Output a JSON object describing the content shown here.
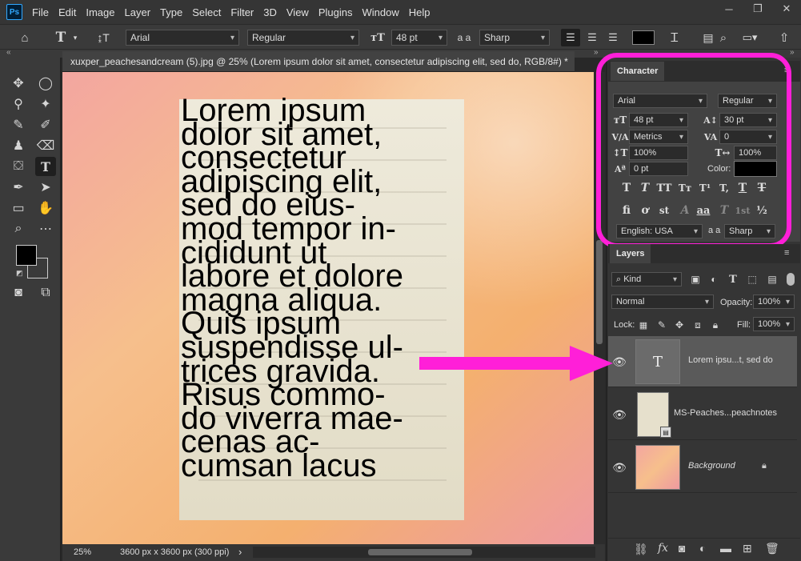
{
  "menubar": {
    "logo": "Ps",
    "items": [
      "File",
      "Edit",
      "Image",
      "Layer",
      "Type",
      "Select",
      "Filter",
      "3D",
      "View",
      "Plugins",
      "Window",
      "Help"
    ]
  },
  "options": {
    "font_family": "Arial",
    "font_style": "Regular",
    "font_size": "48 pt",
    "aa_label": "a a",
    "anti_alias": "Sharp"
  },
  "document": {
    "tab_title": "xuxper_peachesandcream (5).jpg @ 25% (Lorem ipsum dolor sit amet, consectetur adipiscing elit, sed do, RGB/8#) *",
    "tab_close": "×",
    "canvas_text_lines": [
      "Lorem ipsum",
      "dolor sit amet,",
      "consectetur",
      "adipiscing elit,",
      "sed do eius-",
      "mod tempor in-",
      "cididunt ut",
      "labore et dolore",
      "magna aliqua.",
      "Quis ipsum",
      "suspendisse ul-",
      "trices gravida.",
      "Risus commo-",
      "do viverra mae-",
      "cenas ac-",
      "cumsan lacus"
    ]
  },
  "status": {
    "zoom": "25%",
    "doc_info": "3600 px x 3600 px (300 ppi)",
    "arrow": "›"
  },
  "character_panel": {
    "tab": "Character",
    "font_family": "Arial",
    "font_style": "Regular",
    "size": "48 pt",
    "leading": "30 pt",
    "kerning": "Metrics",
    "tracking": "0",
    "vscale": "100%",
    "hscale": "100%",
    "baseline": "0 pt",
    "color_label": "Color:",
    "text_color": "#000000",
    "language": "English: USA",
    "aa_label": "a a",
    "anti_alias": "Sharp",
    "row1_glyphs": [
      "T",
      "T",
      "TT",
      "Tт",
      "T¹",
      "T,",
      "T",
      "T"
    ],
    "row2_glyphs": [
      "fi",
      "ơ",
      "st",
      "A",
      "aa",
      "T",
      "1st",
      "½"
    ]
  },
  "layers_panel": {
    "tab": "Layers",
    "filter": "Kind",
    "blend_mode": "Normal",
    "opacity_label": "Opacity:",
    "opacity": "100%",
    "lock_label": "Lock:",
    "fill_label": "Fill:",
    "fill": "100%",
    "layers": [
      {
        "name": "Lorem ipsu...t, sed do",
        "type": "text",
        "thumb_glyph": "T"
      },
      {
        "name": "MS-Peaches...peachnotes",
        "type": "smart"
      },
      {
        "name": "Background",
        "type": "background"
      }
    ]
  },
  "colors": {
    "annotation_accent": "#ff1fd8",
    "foreground_swatch": "#000000",
    "background_swatch": "#ffffff"
  }
}
